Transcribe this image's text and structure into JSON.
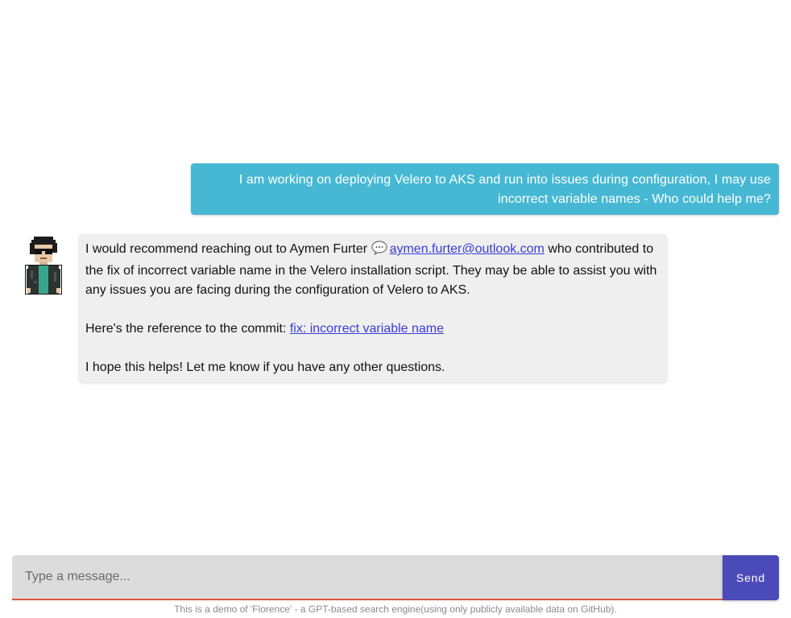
{
  "conversation": {
    "user_message": "I am working on deploying Velero to AKS and run into issues during configuration, I may use incorrect variable names - Who could help me?",
    "bot_reply": {
      "line1_before": "I would recommend reaching out to Aymen Furter",
      "contact_email": "aymen.furter@outlook.com",
      "line1_after": " who contributed to the fix of incorrect variable name in the Velero installation script. They may be able to assist you with any issues you are facing during the configuration of Velero to AKS.",
      "reference_prefix": "Here's the reference to the commit: ",
      "commit_link": "fix: incorrect variable name",
      "closing": "I hope this helps! Let me know if you have any other questions."
    }
  },
  "composer": {
    "placeholder": "Type a message...",
    "send_label": "Send"
  },
  "footer": {
    "note": "This is a demo of 'Florence' - a GPT-based search engine(using only publicly available data on GitHub)."
  },
  "colors": {
    "user_bubble": "#46b8d3",
    "bot_bubble": "#efefef",
    "send_button": "#4a4ab8",
    "input_underline": "#e0523f",
    "link": "#3b3bd6"
  },
  "icons": {
    "avatar": "pixel-avatar-icon",
    "contact": "chat-bubble-icon"
  }
}
